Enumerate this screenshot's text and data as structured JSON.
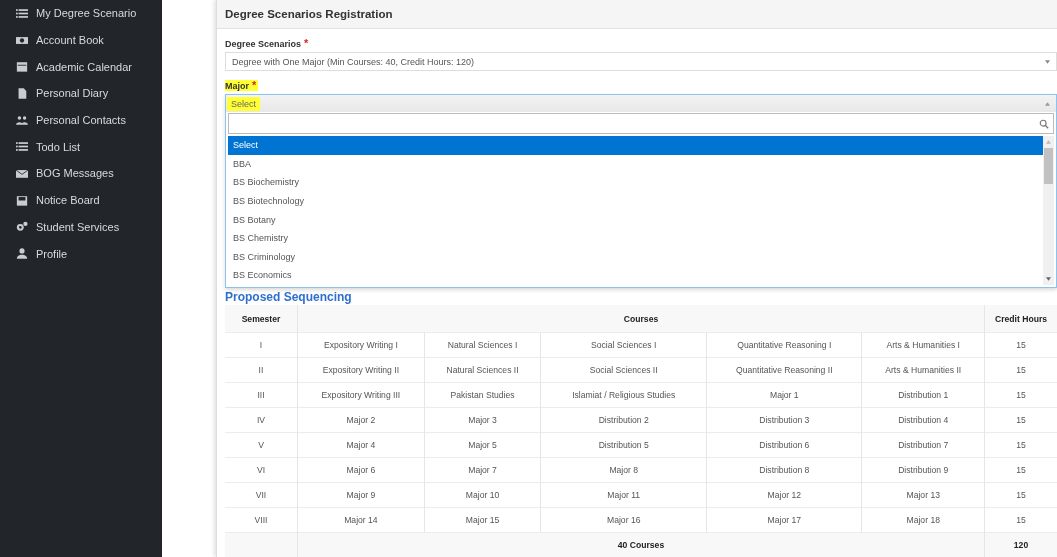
{
  "sidebar": {
    "items": [
      {
        "label": "My Degree Scenario"
      },
      {
        "label": "Account Book"
      },
      {
        "label": "Academic Calendar"
      },
      {
        "label": "Personal Diary"
      },
      {
        "label": "Personal Contacts"
      },
      {
        "label": "Todo List"
      },
      {
        "label": "BOG Messages"
      },
      {
        "label": "Notice Board"
      },
      {
        "label": "Student Services"
      },
      {
        "label": "Profile"
      }
    ]
  },
  "panel": {
    "title": "Degree Scenarios Registration",
    "degree_scenarios": {
      "label": "Degree Scenarios",
      "required_mark": "*",
      "value": "Degree with One Major (Min Courses: 40, Credit Hours: 120)"
    },
    "major": {
      "label": "Major",
      "required_mark": "*",
      "highlighted": true,
      "value": "Select",
      "expanded": true,
      "options": [
        {
          "label": "Select",
          "selected": true
        },
        {
          "label": "BBA",
          "selected": false
        },
        {
          "label": "BS Biochemistry",
          "selected": false
        },
        {
          "label": "BS Biotechnology",
          "selected": false
        },
        {
          "label": "BS Botany",
          "selected": false
        },
        {
          "label": "BS Chemistry",
          "selected": false
        },
        {
          "label": "BS Criminology",
          "selected": false
        },
        {
          "label": "BS Economics",
          "selected": false
        }
      ]
    },
    "section_title": "Proposed Sequencing",
    "table": {
      "columns": [
        "Semester",
        "Courses",
        "Credit Hours"
      ],
      "rows": [
        {
          "semester": "I",
          "courses": [
            "Expository Writing I",
            "Natural Sciences I",
            "Social Sciences I",
            "Quantitative Reasoning I",
            "Arts & Humanities I"
          ],
          "credit_hours": "15"
        },
        {
          "semester": "II",
          "courses": [
            "Expository Writing II",
            "Natural Sciences II",
            "Social Sciences II",
            "Quantitative Reasoning II",
            "Arts & Humanities II"
          ],
          "credit_hours": "15"
        },
        {
          "semester": "III",
          "courses": [
            "Expository Writing III",
            "Pakistan Studies",
            "Islamiat / Religious Studies",
            "Major 1",
            "Distribution 1"
          ],
          "credit_hours": "15"
        },
        {
          "semester": "IV",
          "courses": [
            "Major 2",
            "Major 3",
            "Distribution 2",
            "Distribution 3",
            "Distribution 4"
          ],
          "credit_hours": "15"
        },
        {
          "semester": "V",
          "courses": [
            "Major 4",
            "Major 5",
            "Distribution 5",
            "Distribution 6",
            "Distribution 7"
          ],
          "credit_hours": "15"
        },
        {
          "semester": "VI",
          "courses": [
            "Major 6",
            "Major 7",
            "Major 8",
            "Distribution 8",
            "Distribution 9"
          ],
          "credit_hours": "15"
        },
        {
          "semester": "VII",
          "courses": [
            "Major 9",
            "Major 10",
            "Major 11",
            "Major 12",
            "Major 13"
          ],
          "credit_hours": "15"
        },
        {
          "semester": "VIII",
          "courses": [
            "Major 14",
            "Major 15",
            "Major 16",
            "Major 17",
            "Major 18"
          ],
          "credit_hours": "15"
        }
      ],
      "footer": {
        "courses": "40 Courses",
        "credit_hours": "120"
      }
    }
  }
}
